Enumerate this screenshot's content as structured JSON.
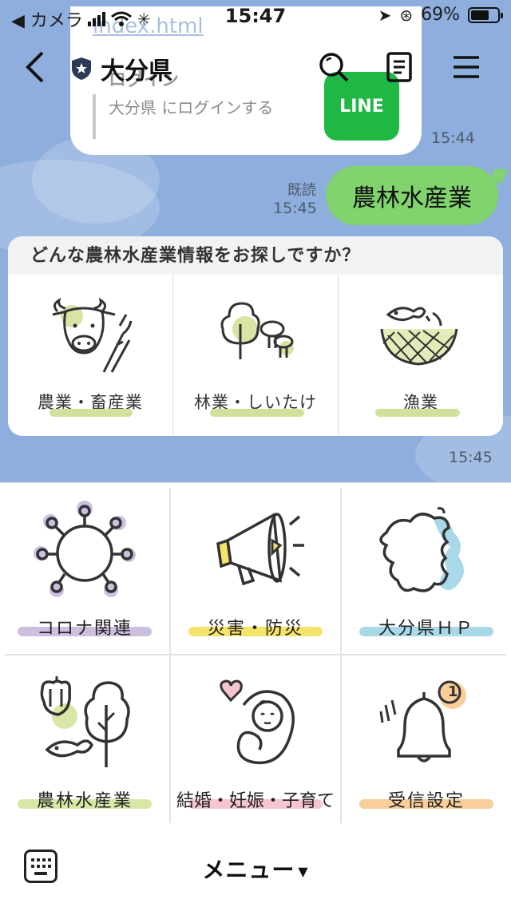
{
  "status_bar": {
    "back_app": "◀ カメラ",
    "time": "15:47",
    "battery_text": "69%",
    "battery_level": 0.69
  },
  "header": {
    "title": "大分県"
  },
  "chat": {
    "previous_card": {
      "link_text": "index.html",
      "login_title": "ログイン",
      "login_desc": "大分県 にログインする",
      "logo_text": "LINE",
      "time": "15:44"
    },
    "user_message": {
      "text": "農林水産業",
      "read": "既読",
      "time": "15:45"
    },
    "flex_card": {
      "question": "どんな農林水産業情報をお探しですか？",
      "options": [
        {
          "label": "農業・畜産業",
          "icon": "cow-icon"
        },
        {
          "label": "林業・しいたけ",
          "icon": "tree-mushroom-icon"
        },
        {
          "label": "漁業",
          "icon": "fish-net-icon"
        }
      ],
      "time": "15:45"
    }
  },
  "rich_menu": {
    "items": [
      {
        "label": "コロナ関連",
        "icon": "virus-icon",
        "color": "#cdbfe0"
      },
      {
        "label": "災害・防災",
        "icon": "megaphone-icon",
        "color": "#f6e36a"
      },
      {
        "label": "大分県ＨＰ",
        "icon": "oita-map-icon",
        "color": "#a9d9e8"
      },
      {
        "label": "農林水産業",
        "icon": "farm-fish-icon",
        "color": "#d8e7a6"
      },
      {
        "label": "結婚・妊娠・子育て",
        "icon": "baby-heart-icon",
        "color": "#f6c6d0"
      },
      {
        "label": "受信設定",
        "icon": "bell-icon",
        "color": "#f8cf9a",
        "badge": "1"
      }
    ]
  },
  "bottom_bar": {
    "menu_label": "メニュー",
    "caret": "▼"
  }
}
